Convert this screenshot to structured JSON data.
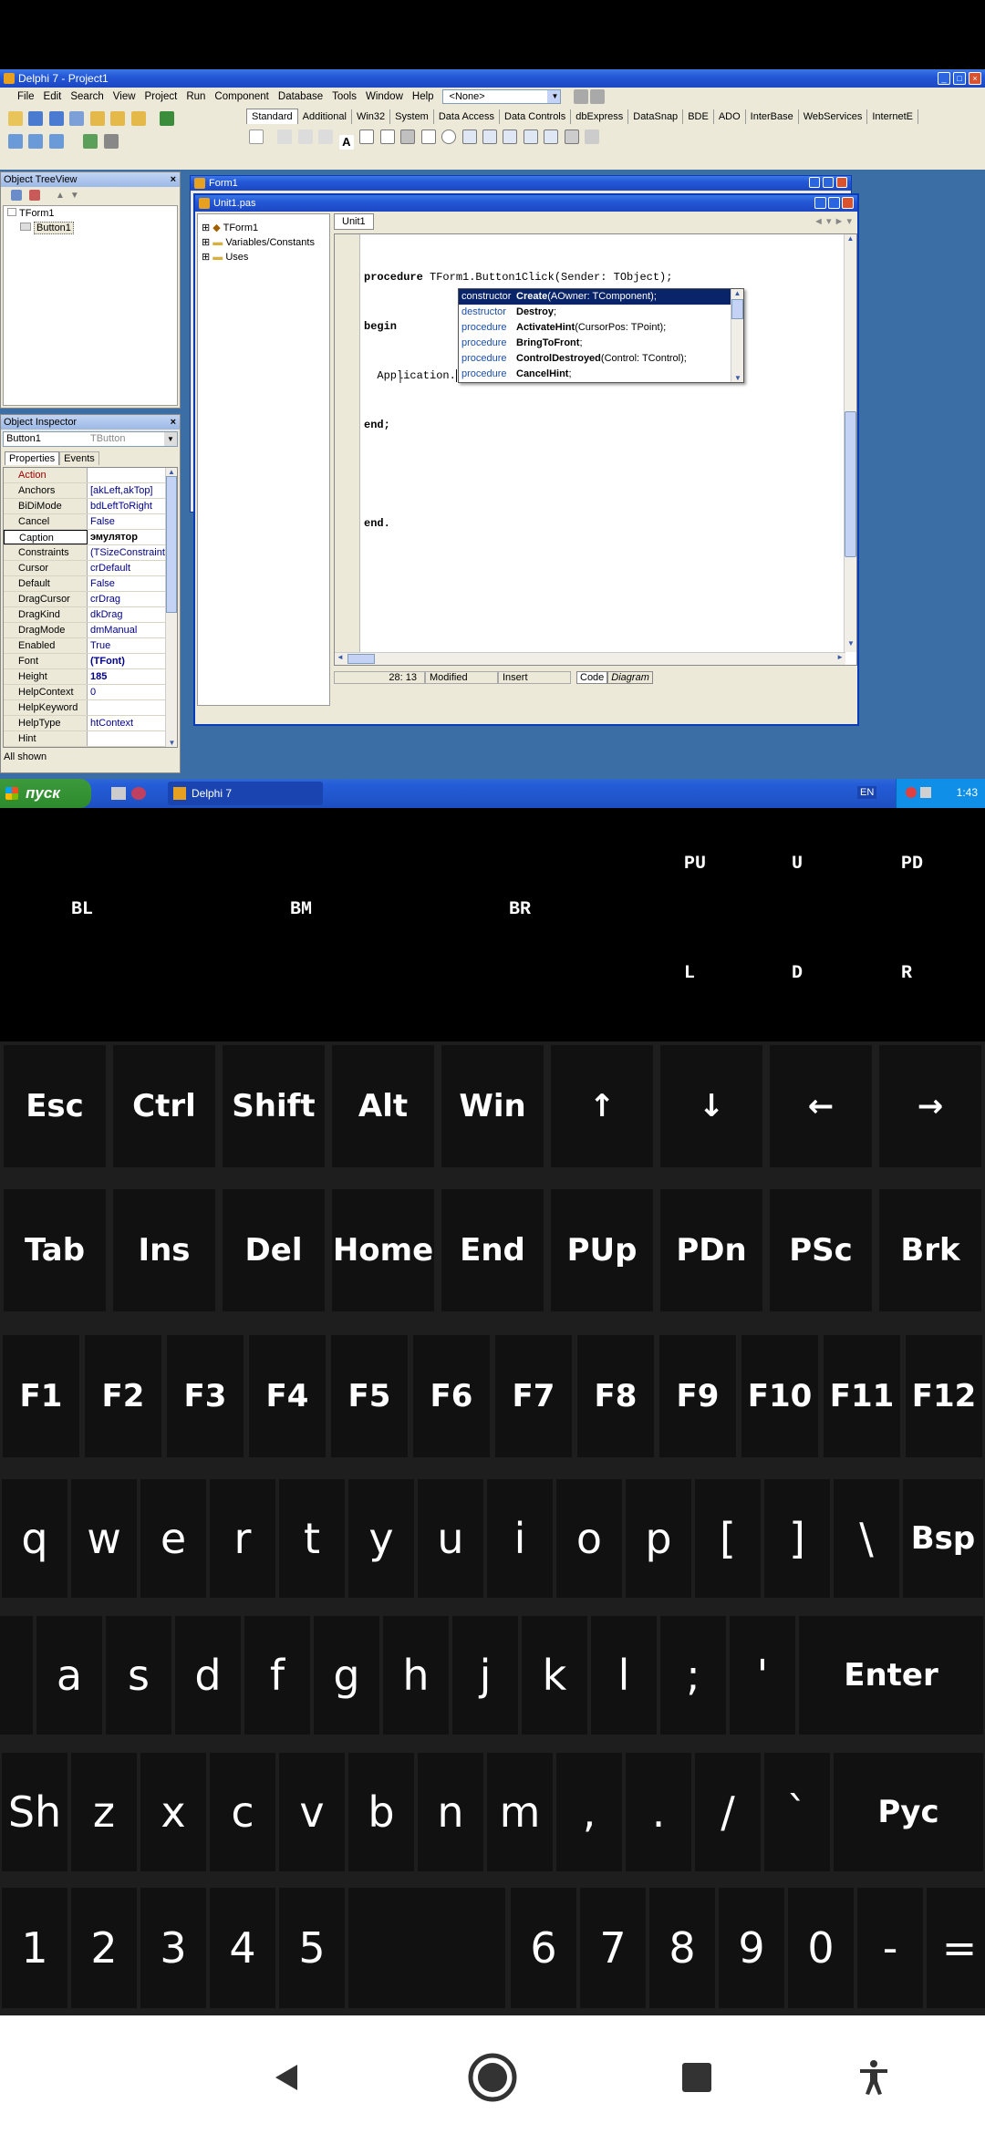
{
  "ide": {
    "title": "Delphi 7 - Project1",
    "menu": [
      "File",
      "Edit",
      "Search",
      "View",
      "Project",
      "Run",
      "Component",
      "Database",
      "Tools",
      "Window",
      "Help"
    ],
    "config_combo": "<None>",
    "palette_tabs": [
      "Standard",
      "Additional",
      "Win32",
      "System",
      "Data Access",
      "Data Controls",
      "dbExpress",
      "DataSnap",
      "BDE",
      "ADO",
      "InterBase",
      "WebServices",
      "InternetE"
    ]
  },
  "tree_view": {
    "title": "Object TreeView",
    "items": [
      "TForm1",
      "Button1"
    ]
  },
  "inspector": {
    "title": "Object Inspector",
    "selected_object": "Button1",
    "selected_type": "TButton",
    "tabs": [
      "Properties",
      "Events"
    ],
    "rows": [
      {
        "k": "Action",
        "v": "",
        "expand": false,
        "kcolor": "#a00000"
      },
      {
        "k": "Anchors",
        "v": "[akLeft,akTop]",
        "expand": true
      },
      {
        "k": "BiDiMode",
        "v": "bdLeftToRight",
        "expand": false
      },
      {
        "k": "Cancel",
        "v": "False",
        "expand": false
      },
      {
        "k": "Caption",
        "v": "эмулятор",
        "expand": false,
        "selected": true
      },
      {
        "k": "Constraints",
        "v": "(TSizeConstraints)",
        "expand": true
      },
      {
        "k": "Cursor",
        "v": "crDefault",
        "expand": false
      },
      {
        "k": "Default",
        "v": "False",
        "expand": false
      },
      {
        "k": "DragCursor",
        "v": "crDrag",
        "expand": false
      },
      {
        "k": "DragKind",
        "v": "dkDrag",
        "expand": false
      },
      {
        "k": "DragMode",
        "v": "dmManual",
        "expand": false
      },
      {
        "k": "Enabled",
        "v": "True",
        "expand": false
      },
      {
        "k": "Font",
        "v": "(TFont)",
        "expand": true,
        "bold": true
      },
      {
        "k": "Height",
        "v": "185",
        "expand": false,
        "bold": true
      },
      {
        "k": "HelpContext",
        "v": "0",
        "expand": false
      },
      {
        "k": "HelpKeyword",
        "v": "",
        "expand": false
      },
      {
        "k": "HelpType",
        "v": "htContext",
        "expand": false
      },
      {
        "k": "Hint",
        "v": "",
        "expand": false
      }
    ],
    "status": "All shown"
  },
  "form_window": {
    "title": "Form1"
  },
  "editor": {
    "title": "Unit1.pas",
    "tab": "Unit1",
    "explorer_items": [
      "TForm1",
      "Variables/Constants",
      "Uses"
    ],
    "code_lines": [
      "procedure TForm1.Button1Click(Sender: TObject);",
      "begin",
      "  Application.",
      "end;",
      "",
      "end."
    ],
    "status_pos": "28: 13",
    "status_modified": "Modified",
    "status_mode": "Insert",
    "bottom_tabs": [
      "Code",
      "Diagram"
    ]
  },
  "autocomplete": [
    {
      "kind": "constructor",
      "name": "Create",
      "sig": "(AOwner: TComponent);",
      "selected": true
    },
    {
      "kind": "destructor",
      "name": "Destroy",
      "sig": ";"
    },
    {
      "kind": "procedure",
      "name": "ActivateHint",
      "sig": "(CursorPos: TPoint);"
    },
    {
      "kind": "procedure",
      "name": "BringToFront",
      "sig": ";"
    },
    {
      "kind": "procedure",
      "name": "ControlDestroyed",
      "sig": "(Control: TControl);"
    },
    {
      "kind": "procedure",
      "name": "CancelHint",
      "sig": ";"
    }
  ],
  "taskbar": {
    "start_label": "пуск",
    "task_label": "Delphi 7",
    "lang": "EN",
    "clock": "1:43"
  },
  "mouse_pad": {
    "labels": [
      "PU",
      "U",
      "PD",
      "BL",
      "BM",
      "BR",
      "L",
      "D",
      "R"
    ]
  },
  "keyboard": {
    "rows": [
      [
        "Esc",
        "Ctrl",
        "Shift",
        "Alt",
        "Win",
        "↑",
        "↓",
        "←",
        "→"
      ],
      [
        "Tab",
        "Ins",
        "Del",
        "Home",
        "End",
        "PUp",
        "PDn",
        "PSc",
        "Brk"
      ],
      [
        "F1",
        "F2",
        "F3",
        "F4",
        "F5",
        "F6",
        "F7",
        "F8",
        "F9",
        "F10",
        "F11",
        "F12"
      ],
      [
        "q",
        "w",
        "e",
        "r",
        "t",
        "y",
        "u",
        "i",
        "o",
        "p",
        "[",
        "]",
        "\\",
        "Bsp"
      ],
      [
        "a",
        "s",
        "d",
        "f",
        "g",
        "h",
        "j",
        "k",
        "l",
        ";",
        "'",
        "Enter"
      ],
      [
        "Sh",
        "z",
        "x",
        "c",
        "v",
        "b",
        "n",
        "m",
        ",",
        ".",
        "/",
        "`",
        "Рус"
      ],
      [
        "1",
        "2",
        "3",
        "4",
        "5",
        "6",
        "7",
        "8",
        "9",
        "0",
        "-",
        "="
      ]
    ]
  },
  "navbar": [
    "back",
    "home",
    "recents",
    "accessibility"
  ]
}
